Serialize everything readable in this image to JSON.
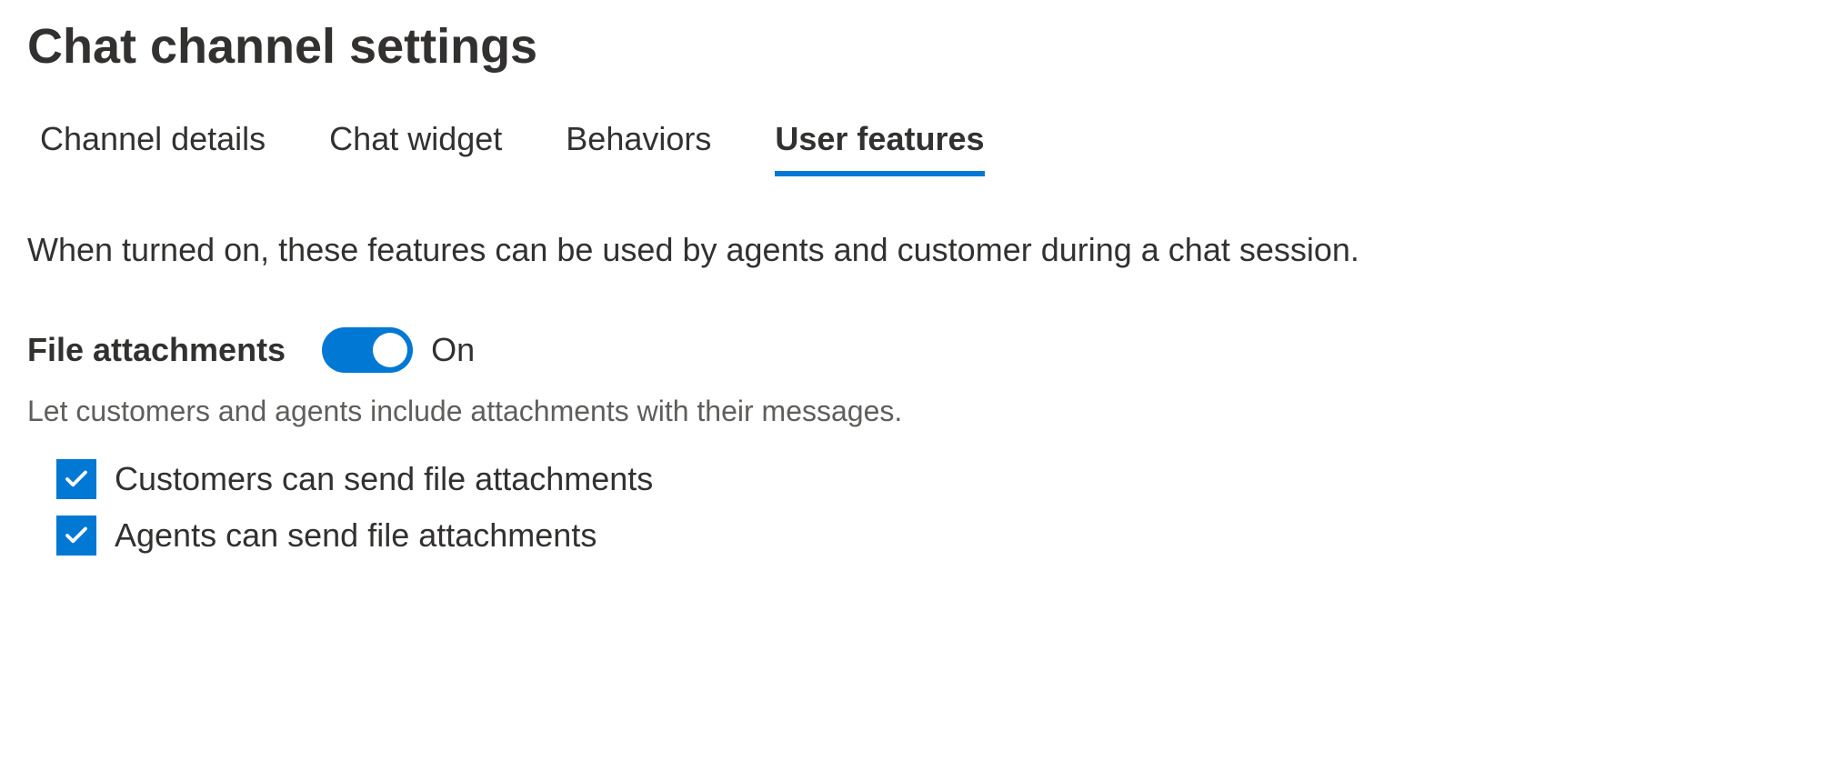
{
  "page_title": "Chat channel settings",
  "tabs": [
    {
      "label": "Channel details",
      "active": false
    },
    {
      "label": "Chat widget",
      "active": false
    },
    {
      "label": "Behaviors",
      "active": false
    },
    {
      "label": "User features",
      "active": true
    }
  ],
  "description": "When turned on, these features can be used by agents and customer during a chat session.",
  "section": {
    "label": "File attachments",
    "toggle_state": "On",
    "helper": "Let customers and agents include attachments with their messages.",
    "options": [
      {
        "label": "Customers can send file attachments",
        "checked": true
      },
      {
        "label": "Agents can send file attachments",
        "checked": true
      }
    ]
  }
}
